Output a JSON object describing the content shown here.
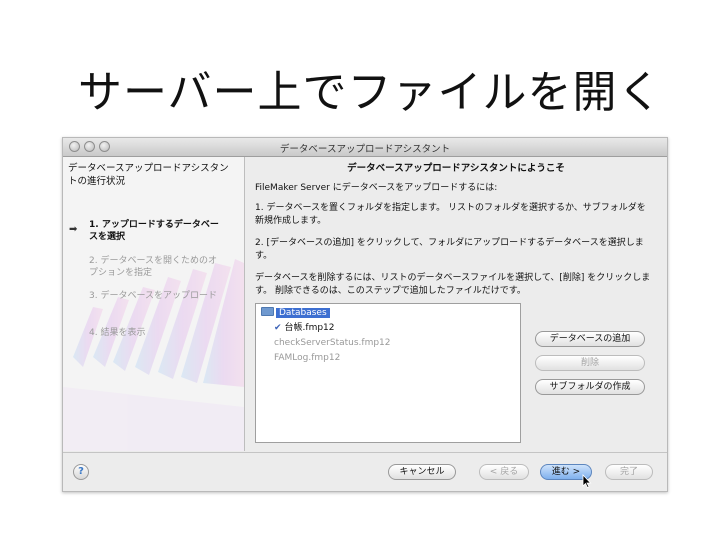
{
  "slide": {
    "title": "サーバー上でファイルを開く"
  },
  "window": {
    "title": "データベースアップロードアシスタント"
  },
  "sidebar": {
    "title": "データベースアップロードアシスタントの進行状況",
    "steps": [
      {
        "label": "1. アップロードするデータベースを選択",
        "active": true
      },
      {
        "label": "2. データベースを開くためのオプションを指定",
        "active": false
      },
      {
        "label": "3. データベースをアップロード",
        "active": false
      },
      {
        "label": "4. 結果を表示",
        "active": false
      }
    ]
  },
  "main": {
    "heading": "データベースアップロードアシスタントにようこそ",
    "paragraphs": [
      "FileMaker Server にデータベースをアップロードするには:",
      "1. データベースを置くフォルダを指定します。 リストのフォルダを選択するか、サブフォルダを新規作成します。",
      "2. [データベースの追加] をクリックして、フォルダにアップロードするデータベースを選択します。",
      "データベースを削除するには、リストのデータベースファイルを選択して、[削除] をクリックします。 削除できるのは、このステップで追加したファイルだけです。"
    ],
    "file_list": {
      "root": "Databases",
      "items": [
        {
          "name": "台帳.fmp12",
          "checked": true,
          "dimmed": false
        },
        {
          "name": "checkServerStatus.fmp12",
          "checked": false,
          "dimmed": true
        },
        {
          "name": "FAMLog.fmp12",
          "checked": false,
          "dimmed": true
        }
      ]
    },
    "buttons": {
      "add": "データベースの追加",
      "delete": "削除",
      "create_subfolder": "サブフォルダの作成"
    }
  },
  "footer": {
    "help": "?",
    "cancel": "キャンセル",
    "back": "< 戻る",
    "next": "進む >",
    "finish": "完了"
  },
  "colors": {
    "selection": "#3d6fd1",
    "default_button": "#7fb0ee",
    "check": "#3b62b7"
  }
}
